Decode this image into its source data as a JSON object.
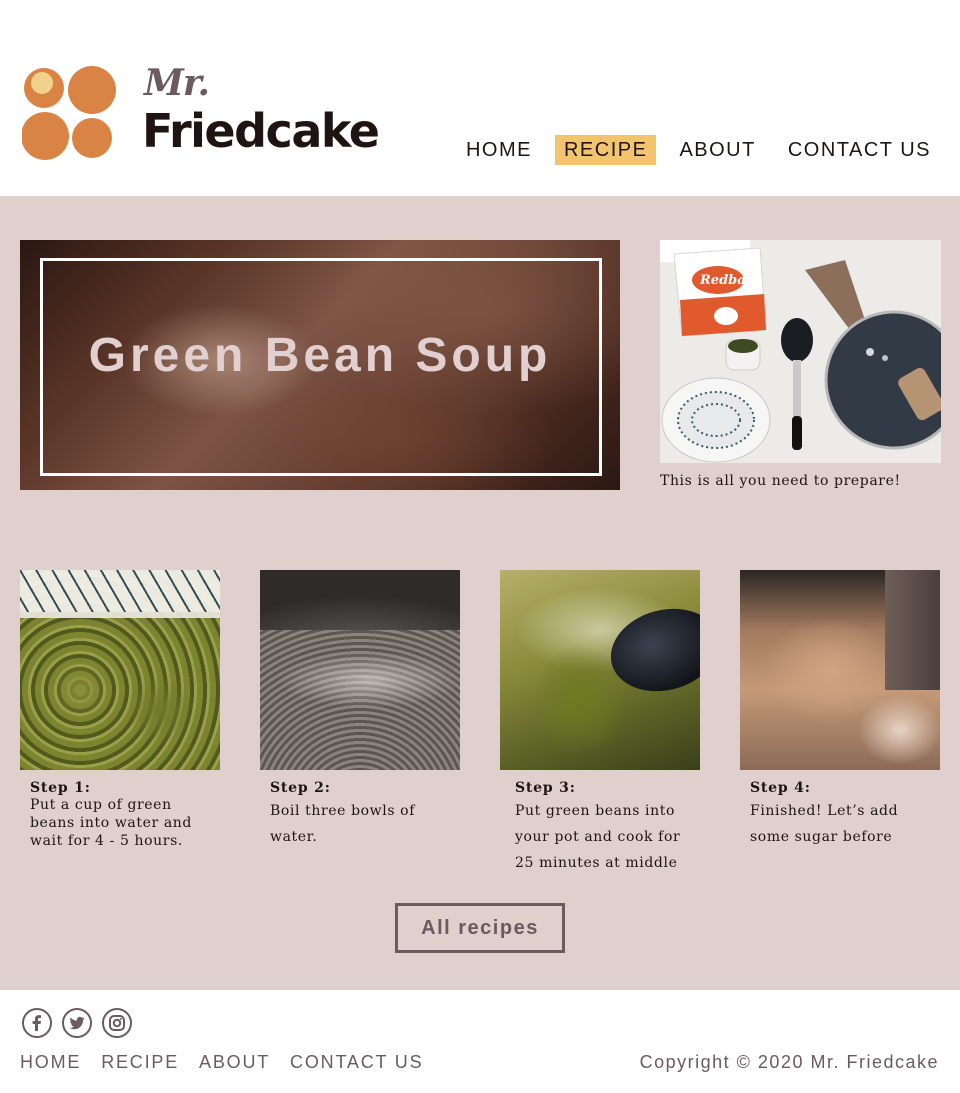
{
  "brand": {
    "mr": "Mr.",
    "name": "Friedcake"
  },
  "nav": {
    "items": [
      {
        "label": "HOME",
        "active": false
      },
      {
        "label": "RECIPE",
        "active": true
      },
      {
        "label": "ABOUT",
        "active": false
      },
      {
        "label": "CONTACT US",
        "active": false
      }
    ]
  },
  "hero": {
    "title": "Green Bean Soup"
  },
  "prep": {
    "caption": "This is all you need to prepare!"
  },
  "steps": [
    {
      "title": "Step 1:",
      "text_lines": [
        "Put a cup of green",
        "beans into water and",
        "wait for 4 - 5 hours."
      ]
    },
    {
      "title": "Step 2:",
      "text_lines": [
        "Boil three bowls of",
        "water."
      ]
    },
    {
      "title": "Step 3:",
      "text_lines": [
        "Put green beans into",
        "your pot and cook for",
        "25 minutes at middle"
      ]
    },
    {
      "title": "Step 4:",
      "text_lines": [
        "Finished! Let’s add",
        "some sugar before"
      ]
    }
  ],
  "button": {
    "all_recipes": "All recipes"
  },
  "footer": {
    "socials": [
      "facebook-icon",
      "twitter-icon",
      "instagram-icon"
    ],
    "links": [
      "HOME",
      "RECIPE",
      "ABOUT",
      "CONTACT US"
    ],
    "copyright": "Copyright © 2020 Mr. Friedcake"
  },
  "colors": {
    "accent": "#f2c46e",
    "main_bg": "#dfcfcd",
    "text_dark": "#1e1414",
    "text_muted": "#6b5a5f",
    "logo_orange": "#d98445"
  }
}
